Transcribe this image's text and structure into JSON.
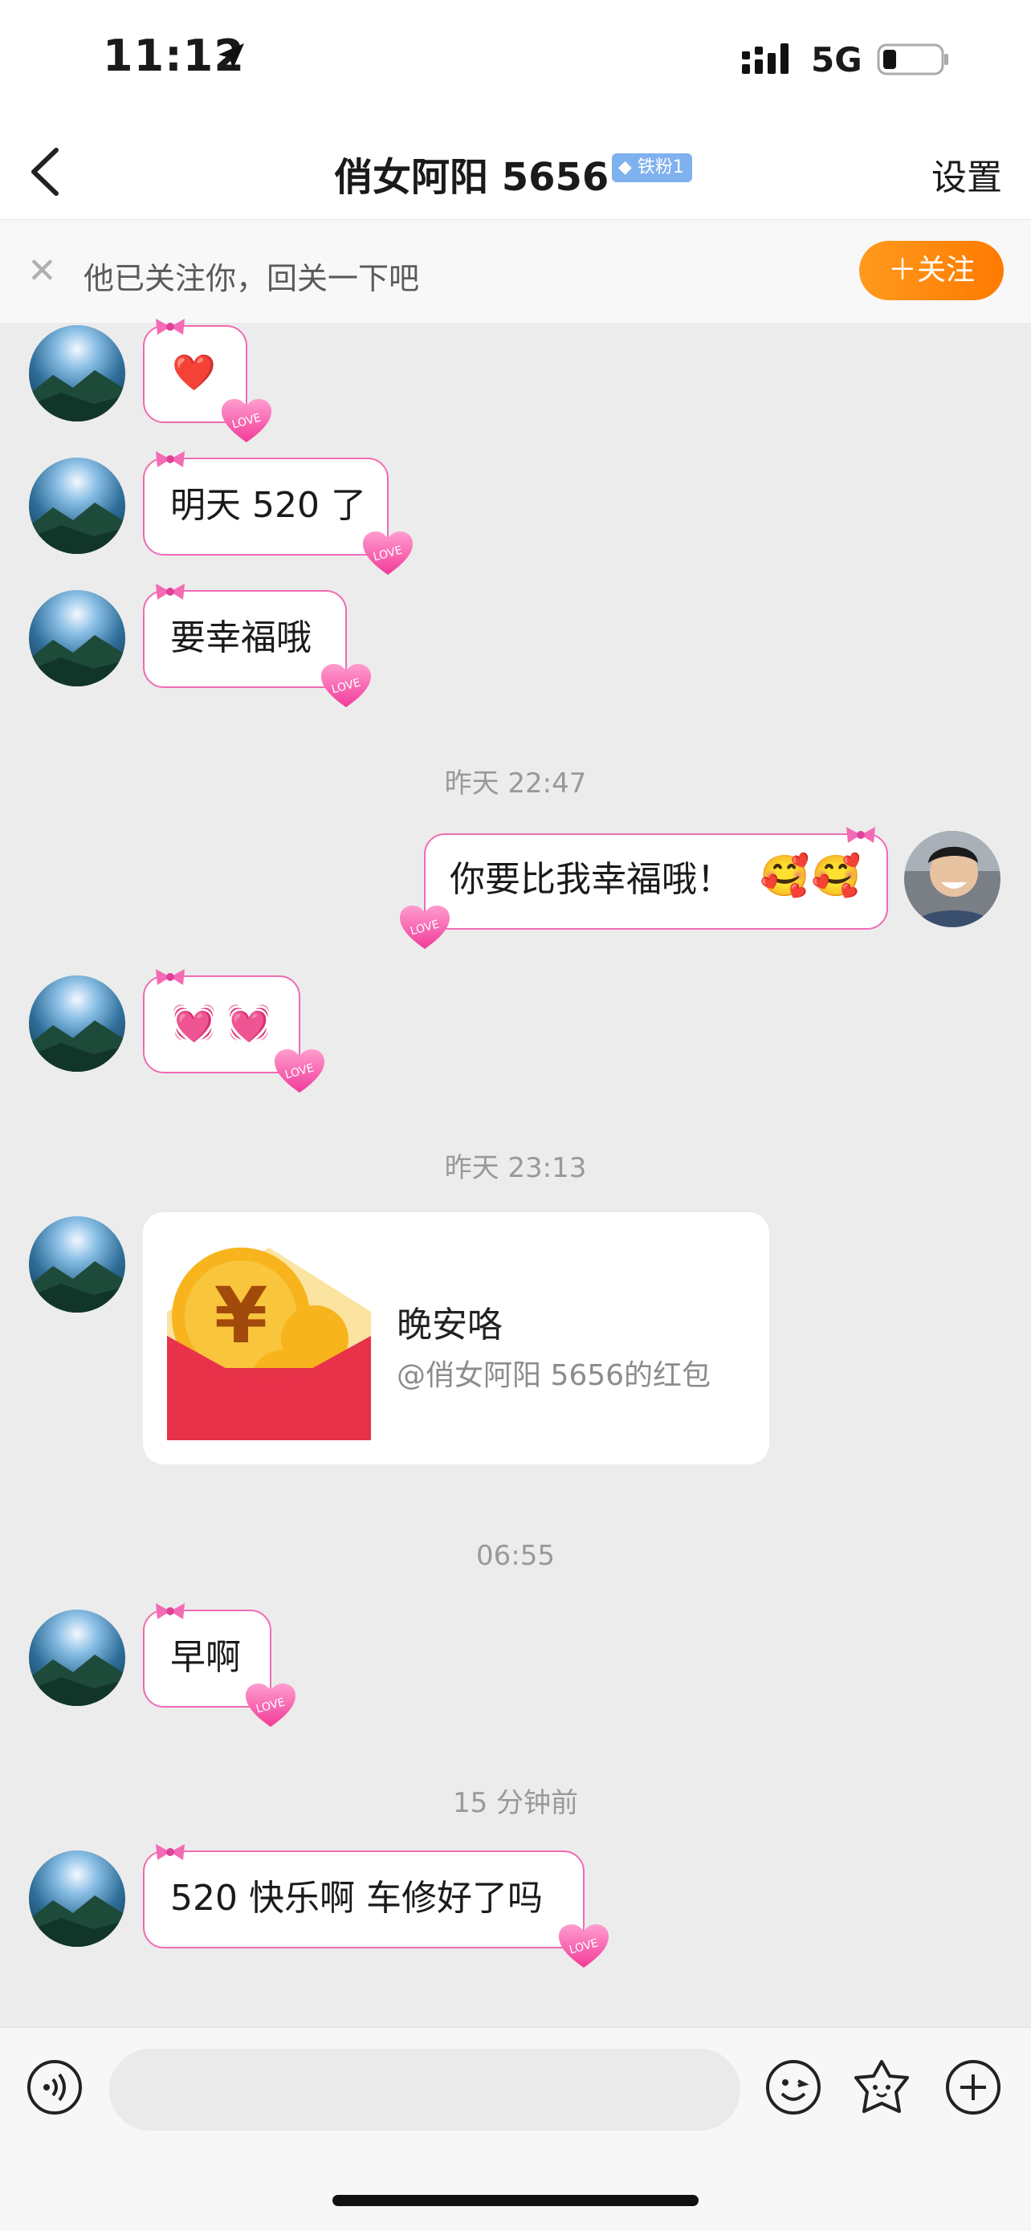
{
  "status": {
    "time": "11:12",
    "network": "5G"
  },
  "nav": {
    "title": "俏女阿阳 5656",
    "badge": "铁粉1",
    "settings": "设置"
  },
  "follow_bar": {
    "text": "他已关注你，回关一下吧",
    "button": "＋关注"
  },
  "messages": [
    {
      "text": "❤️"
    },
    {
      "text": "明天 520 了"
    },
    {
      "text": "要幸福哦"
    },
    {
      "timestamp": "昨天 22:47"
    },
    {
      "text": "你要比我幸福哦！",
      "from": "me"
    },
    {
      "text": "💓 💓"
    },
    {
      "timestamp": "昨天 23:13"
    },
    {
      "red_packet_title": "晚安咯",
      "red_packet_sub": "@俏女阿阳 5656的红包"
    },
    {
      "timestamp": "06:55"
    },
    {
      "text": "早啊"
    },
    {
      "timestamp": "15 分钟前"
    },
    {
      "text": "520 快乐啊 车修好了吗"
    }
  ],
  "icons": [
    "back-arrow-icon",
    "location-arrow-icon",
    "signal-icon",
    "battery-icon",
    "close-icon",
    "voice-icon",
    "emoji-icon",
    "sticker-icon",
    "plus-icon"
  ],
  "colors": {
    "accent": "#ff8a00",
    "bubble_border": "#f06bb3",
    "red_packet": "#e8324a"
  }
}
